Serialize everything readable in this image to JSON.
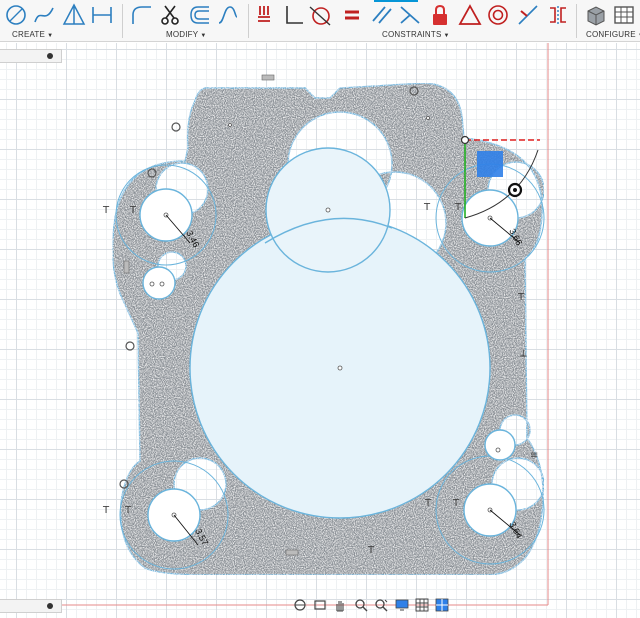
{
  "toolbar": {
    "groups": [
      {
        "label": "CREATE"
      },
      {
        "label": "MODIFY"
      },
      {
        "label": "CONSTRAINTS"
      },
      {
        "label": "CONFIGURE"
      }
    ]
  },
  "canvas": {
    "dimensions": [
      "3.46",
      "3.66",
      "3.57",
      "3.64"
    ]
  },
  "colors": {
    "sketch_line": "#6ab4dc",
    "part_fill": "#8a9096",
    "profile_fill": "#e6f3fa",
    "axis_red": "#e02020",
    "axis_green": "#22b022",
    "selection_blue": "#2f80e8",
    "boundary_red": "#e58a8a"
  }
}
